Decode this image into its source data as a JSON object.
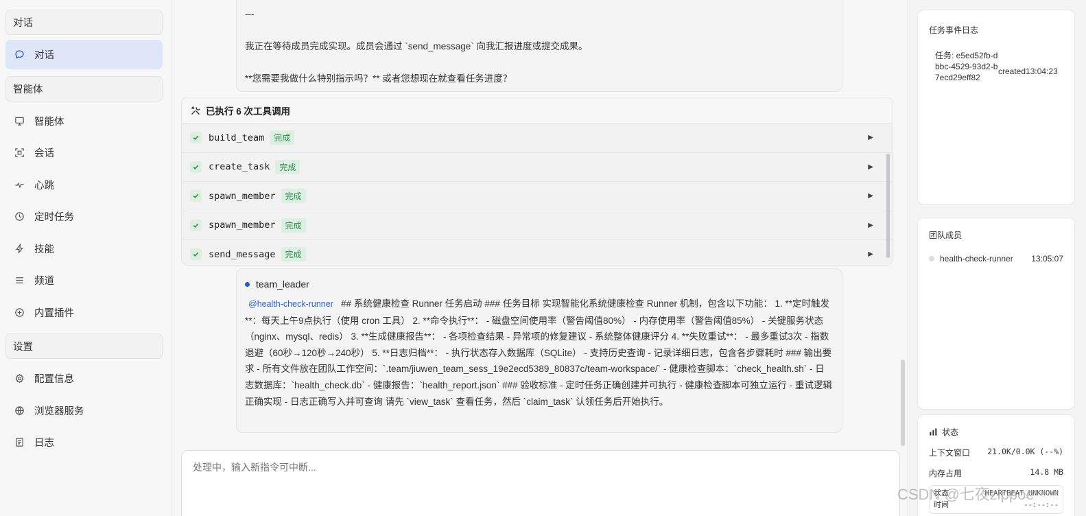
{
  "sidebar": {
    "sections": [
      {
        "title": "对话",
        "items": [
          {
            "label": "对话",
            "icon": "chat-bubble-icon",
            "active": true
          }
        ]
      },
      {
        "title": "智能体",
        "items": [
          {
            "label": "智能体",
            "icon": "monitor-icon"
          },
          {
            "label": "会话",
            "icon": "scan-icon"
          },
          {
            "label": "心跳",
            "icon": "pulse-icon"
          },
          {
            "label": "定时任务",
            "icon": "clock-icon"
          },
          {
            "label": "技能",
            "icon": "lightning-icon"
          },
          {
            "label": "频道",
            "icon": "menu-icon"
          },
          {
            "label": "内置插件",
            "icon": "plus-circle-icon"
          }
        ]
      },
      {
        "title": "设置",
        "items": [
          {
            "label": "配置信息",
            "icon": "gear-icon"
          },
          {
            "label": "浏览器服务",
            "icon": "globe-icon"
          },
          {
            "label": "日志",
            "icon": "document-icon"
          }
        ]
      }
    ]
  },
  "main": {
    "top_message": {
      "line1": "---",
      "line2": "我正在等待成员完成实现。成员会通过 `send_message` 向我汇报进度或提交成果。",
      "line3": "**您需要我做什么特别指示吗？** 或者您想现在就查看任务进度？"
    },
    "tools": {
      "header": "已执行 6 次工具调用",
      "items": [
        {
          "name": "build_team",
          "status": "完成"
        },
        {
          "name": "create_task",
          "status": "完成"
        },
        {
          "name": "spawn_member",
          "status": "完成"
        },
        {
          "name": "spawn_member",
          "status": "完成"
        },
        {
          "name": "send_message",
          "status": "完成"
        }
      ]
    },
    "leader_message": {
      "sender": "team_leader",
      "mention": "@health-check-runner",
      "text": "## 系统健康检查 Runner 任务启动 ### 任务目标 实现智能化系统健康检查 Runner 机制，包含以下功能： 1. **定时触发**：每天上午9点执行（使用 cron 工具） 2. **命令执行**： - 磁盘空间使用率（警告阈值80%） - 内存使用率（警告阈值85%） - 关键服务状态（nginx、mysql、redis） 3. **生成健康报告**： - 各项检查结果 - 异常项的修复建议 - 系统整体健康评分 4. **失败重试**： - 最多重试3次 - 指数退避（60秒→120秒→240秒） 5. **日志归档**： - 执行状态存入数据库（SQLite） - 支持历史查询 - 记录详细日志，包含各步骤耗时 ### 输出要求 - 所有文件放在团队工作空间：`.team/jiuwen_team_sess_19e2ecd5389_80837c/team-workspace/` - 健康检查脚本：`check_health.sh` - 日志数据库：`health_check.db` - 健康报告：`health_report.json` ### 验收标准 - 定时任务正确创建并可执行 - 健康检查脚本可独立运行 - 重试逻辑正确实现 - 日志正确写入并可查询 请先 `view_task` 查看任务，然后 `claim_task` 认领任务后开始执行。"
    },
    "input": {
      "placeholder": "处理中，输入新指令可中断..."
    }
  },
  "right_panel": {
    "events": {
      "title": "任务事件日志",
      "items": [
        {
          "task": "任务: e5ed52fb-dbbc-4529-93d2-b7ecd29eff82",
          "status": "created",
          "time": "13:04:23"
        }
      ]
    },
    "team": {
      "title": "团队成员",
      "members": [
        {
          "name": "health-check-runner",
          "time": "13:05:07"
        }
      ]
    },
    "status": {
      "title": "状态",
      "rows": [
        {
          "label": "上下文窗口",
          "value": "21.0K/0.0K (--%)"
        },
        {
          "label": "内存占用",
          "value": "14.8 MB"
        }
      ],
      "heartbeat": {
        "label1": "状态",
        "value1": "HEARTBEAT_UNKNOWN",
        "label2": "时间",
        "value2": "--:--:--"
      }
    }
  },
  "watermark": "CSDN @七夜zippoe"
}
